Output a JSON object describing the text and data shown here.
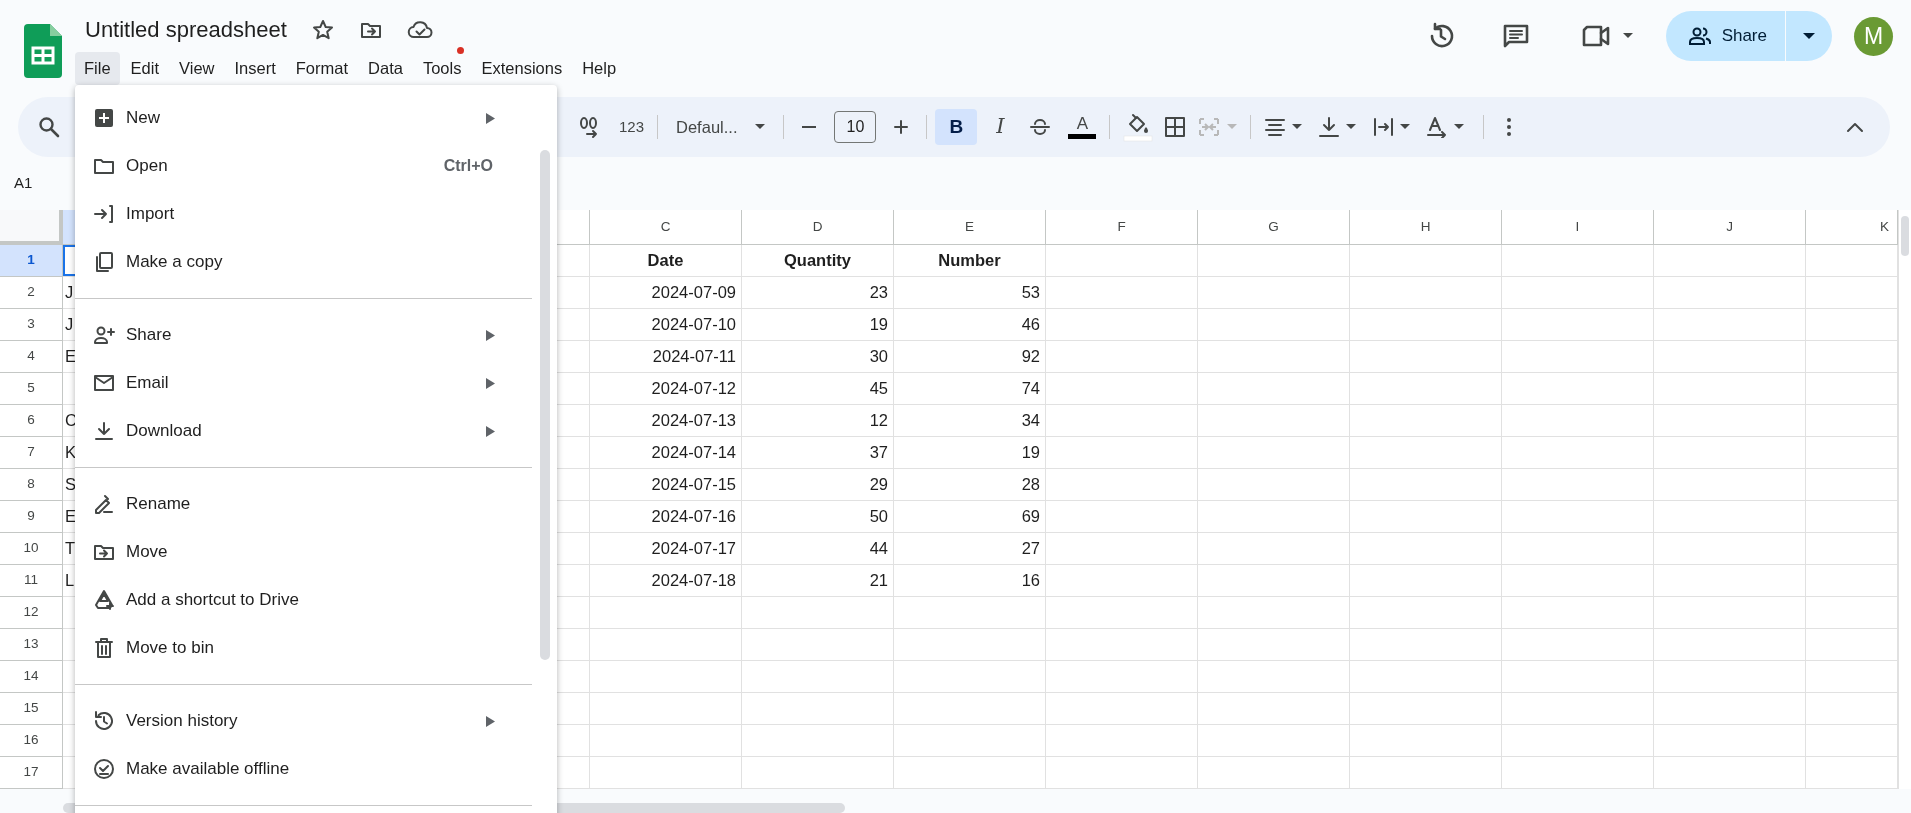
{
  "app": {
    "title": "Untitled spreadsheet",
    "has_unread": true
  },
  "menu_bar": [
    {
      "label": "File",
      "selected": true
    },
    {
      "label": "Edit",
      "selected": false
    },
    {
      "label": "View",
      "selected": false
    },
    {
      "label": "Insert",
      "selected": false
    },
    {
      "label": "Format",
      "selected": false
    },
    {
      "label": "Data",
      "selected": false
    },
    {
      "label": "Tools",
      "selected": false
    },
    {
      "label": "Extensions",
      "selected": false
    },
    {
      "label": "Help",
      "selected": false
    }
  ],
  "header_actions": {
    "share_label": "Share",
    "avatar_letter": "M"
  },
  "toolbar": {
    "number_format": "123",
    "font": "Defaul...",
    "font_size": "10",
    "bold": {
      "glyph": "B",
      "active": true
    },
    "italic_glyph": "I",
    "text_color_glyph": "A",
    "merge_disabled": true
  },
  "name_box": "A1",
  "sheet": {
    "columns": [
      "C",
      "D",
      "E",
      "F",
      "G",
      "H",
      "I",
      "J",
      "K"
    ],
    "row_numbers": [
      "1",
      "2",
      "3",
      "4",
      "5",
      "6",
      "7",
      "8",
      "9",
      "10",
      "11",
      "12",
      "13",
      "14",
      "15",
      "16",
      "17"
    ],
    "rows": [
      {
        "selected": true,
        "bold": true,
        "cells": {
          "C": "Date",
          "D": "Quantity",
          "E": "Number"
        }
      },
      {
        "selected": false,
        "bold": false,
        "cells": {
          "A": "J",
          "C": "2024-07-09",
          "D": "23",
          "E": "53"
        }
      },
      {
        "selected": false,
        "bold": false,
        "cells": {
          "A": "J",
          "C": "2024-07-10",
          "D": "19",
          "E": "46"
        }
      },
      {
        "selected": false,
        "bold": false,
        "cells": {
          "A": "E",
          "C": "2024-07-11",
          "D": "30",
          "E": "92"
        }
      },
      {
        "selected": false,
        "bold": false,
        "cells": {
          "C": "2024-07-12",
          "D": "45",
          "E": "74"
        }
      },
      {
        "selected": false,
        "bold": false,
        "cells": {
          "A": "C",
          "C": "2024-07-13",
          "D": "12",
          "E": "34"
        }
      },
      {
        "selected": false,
        "bold": false,
        "cells": {
          "A": "K",
          "C": "2024-07-14",
          "D": "37",
          "E": "19"
        }
      },
      {
        "selected": false,
        "bold": false,
        "cells": {
          "A": "S",
          "C": "2024-07-15",
          "D": "29",
          "E": "28"
        }
      },
      {
        "selected": false,
        "bold": false,
        "cells": {
          "A": "E",
          "C": "2024-07-16",
          "D": "50",
          "E": "69"
        }
      },
      {
        "selected": false,
        "bold": false,
        "cells": {
          "A": "T",
          "C": "2024-07-17",
          "D": "44",
          "E": "27"
        }
      },
      {
        "selected": false,
        "bold": false,
        "cells": {
          "A": "L",
          "C": "2024-07-18",
          "D": "21",
          "E": "16"
        }
      }
    ]
  },
  "file_menu": {
    "items": [
      {
        "kind": "item",
        "label": "New",
        "submenu": true
      },
      {
        "kind": "item",
        "label": "Open",
        "shortcut": "Ctrl+O",
        "submenu": false
      },
      {
        "kind": "item",
        "label": "Import",
        "submenu": false
      },
      {
        "kind": "item",
        "label": "Make a copy",
        "submenu": false
      },
      {
        "kind": "divider"
      },
      {
        "kind": "item",
        "label": "Share",
        "submenu": true
      },
      {
        "kind": "item",
        "label": "Email",
        "submenu": true
      },
      {
        "kind": "item",
        "label": "Download",
        "submenu": true
      },
      {
        "kind": "divider"
      },
      {
        "kind": "item",
        "label": "Rename",
        "submenu": false
      },
      {
        "kind": "item",
        "label": "Move",
        "submenu": false
      },
      {
        "kind": "item",
        "label": "Add a shortcut to Drive",
        "submenu": false
      },
      {
        "kind": "item",
        "label": "Move to bin",
        "submenu": false
      },
      {
        "kind": "divider"
      },
      {
        "kind": "item",
        "label": "Version history",
        "submenu": true
      },
      {
        "kind": "item",
        "label": "Make available offline",
        "submenu": false
      },
      {
        "kind": "divider"
      }
    ]
  }
}
